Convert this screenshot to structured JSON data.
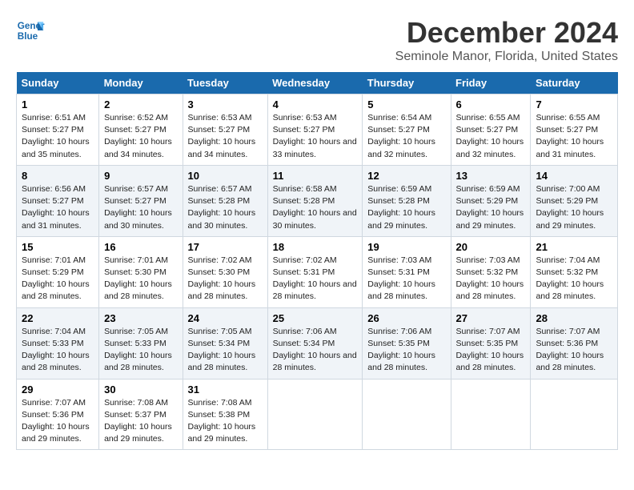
{
  "header": {
    "logo_line1": "General",
    "logo_line2": "Blue",
    "month_title": "December 2024",
    "location": "Seminole Manor, Florida, United States"
  },
  "weekdays": [
    "Sunday",
    "Monday",
    "Tuesday",
    "Wednesday",
    "Thursday",
    "Friday",
    "Saturday"
  ],
  "weeks": [
    [
      {
        "day": "1",
        "sunrise": "6:51 AM",
        "sunset": "5:27 PM",
        "daylight": "10 hours and 35 minutes."
      },
      {
        "day": "2",
        "sunrise": "6:52 AM",
        "sunset": "5:27 PM",
        "daylight": "10 hours and 34 minutes."
      },
      {
        "day": "3",
        "sunrise": "6:53 AM",
        "sunset": "5:27 PM",
        "daylight": "10 hours and 34 minutes."
      },
      {
        "day": "4",
        "sunrise": "6:53 AM",
        "sunset": "5:27 PM",
        "daylight": "10 hours and 33 minutes."
      },
      {
        "day": "5",
        "sunrise": "6:54 AM",
        "sunset": "5:27 PM",
        "daylight": "10 hours and 32 minutes."
      },
      {
        "day": "6",
        "sunrise": "6:55 AM",
        "sunset": "5:27 PM",
        "daylight": "10 hours and 32 minutes."
      },
      {
        "day": "7",
        "sunrise": "6:55 AM",
        "sunset": "5:27 PM",
        "daylight": "10 hours and 31 minutes."
      }
    ],
    [
      {
        "day": "8",
        "sunrise": "6:56 AM",
        "sunset": "5:27 PM",
        "daylight": "10 hours and 31 minutes."
      },
      {
        "day": "9",
        "sunrise": "6:57 AM",
        "sunset": "5:27 PM",
        "daylight": "10 hours and 30 minutes."
      },
      {
        "day": "10",
        "sunrise": "6:57 AM",
        "sunset": "5:28 PM",
        "daylight": "10 hours and 30 minutes."
      },
      {
        "day": "11",
        "sunrise": "6:58 AM",
        "sunset": "5:28 PM",
        "daylight": "10 hours and 30 minutes."
      },
      {
        "day": "12",
        "sunrise": "6:59 AM",
        "sunset": "5:28 PM",
        "daylight": "10 hours and 29 minutes."
      },
      {
        "day": "13",
        "sunrise": "6:59 AM",
        "sunset": "5:29 PM",
        "daylight": "10 hours and 29 minutes."
      },
      {
        "day": "14",
        "sunrise": "7:00 AM",
        "sunset": "5:29 PM",
        "daylight": "10 hours and 29 minutes."
      }
    ],
    [
      {
        "day": "15",
        "sunrise": "7:01 AM",
        "sunset": "5:29 PM",
        "daylight": "10 hours and 28 minutes."
      },
      {
        "day": "16",
        "sunrise": "7:01 AM",
        "sunset": "5:30 PM",
        "daylight": "10 hours and 28 minutes."
      },
      {
        "day": "17",
        "sunrise": "7:02 AM",
        "sunset": "5:30 PM",
        "daylight": "10 hours and 28 minutes."
      },
      {
        "day": "18",
        "sunrise": "7:02 AM",
        "sunset": "5:31 PM",
        "daylight": "10 hours and 28 minutes."
      },
      {
        "day": "19",
        "sunrise": "7:03 AM",
        "sunset": "5:31 PM",
        "daylight": "10 hours and 28 minutes."
      },
      {
        "day": "20",
        "sunrise": "7:03 AM",
        "sunset": "5:32 PM",
        "daylight": "10 hours and 28 minutes."
      },
      {
        "day": "21",
        "sunrise": "7:04 AM",
        "sunset": "5:32 PM",
        "daylight": "10 hours and 28 minutes."
      }
    ],
    [
      {
        "day": "22",
        "sunrise": "7:04 AM",
        "sunset": "5:33 PM",
        "daylight": "10 hours and 28 minutes."
      },
      {
        "day": "23",
        "sunrise": "7:05 AM",
        "sunset": "5:33 PM",
        "daylight": "10 hours and 28 minutes."
      },
      {
        "day": "24",
        "sunrise": "7:05 AM",
        "sunset": "5:34 PM",
        "daylight": "10 hours and 28 minutes."
      },
      {
        "day": "25",
        "sunrise": "7:06 AM",
        "sunset": "5:34 PM",
        "daylight": "10 hours and 28 minutes."
      },
      {
        "day": "26",
        "sunrise": "7:06 AM",
        "sunset": "5:35 PM",
        "daylight": "10 hours and 28 minutes."
      },
      {
        "day": "27",
        "sunrise": "7:07 AM",
        "sunset": "5:35 PM",
        "daylight": "10 hours and 28 minutes."
      },
      {
        "day": "28",
        "sunrise": "7:07 AM",
        "sunset": "5:36 PM",
        "daylight": "10 hours and 28 minutes."
      }
    ],
    [
      {
        "day": "29",
        "sunrise": "7:07 AM",
        "sunset": "5:36 PM",
        "daylight": "10 hours and 29 minutes."
      },
      {
        "day": "30",
        "sunrise": "7:08 AM",
        "sunset": "5:37 PM",
        "daylight": "10 hours and 29 minutes."
      },
      {
        "day": "31",
        "sunrise": "7:08 AM",
        "sunset": "5:38 PM",
        "daylight": "10 hours and 29 minutes."
      },
      null,
      null,
      null,
      null
    ]
  ]
}
